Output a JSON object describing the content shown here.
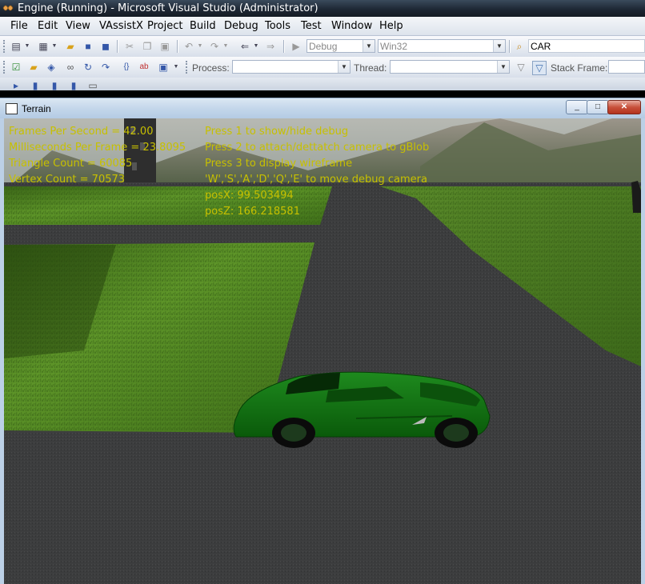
{
  "app": {
    "title": "Engine (Running) - Microsoft Visual Studio (Administrator)"
  },
  "menu": [
    "File",
    "Edit",
    "View",
    "VAssistX",
    "Project",
    "Build",
    "Debug",
    "Tools",
    "Test",
    "Window",
    "Help"
  ],
  "toolbar": {
    "config_value": "Debug",
    "platform_value": "Win32",
    "find_value": "CAR",
    "process_label": "Process:",
    "thread_label": "Thread:",
    "stack_frame_label": "Stack Frame:"
  },
  "terrain_window": {
    "title": "Terrain",
    "minimize": "_",
    "maximize": "□",
    "close": "✕"
  },
  "hud": {
    "fps": "Frames Per Second = 42.00",
    "mspf": "Milliseconds Per Frame = 23.8095",
    "triangles": "Triangle Count = 60085",
    "vertices": "Vertex Count = 70573",
    "help1": "Press 1 to show/hide debug",
    "help2": "Press 2 to attach/dettatch camera to gBlob",
    "help3": "Press 3 to display wireframe",
    "help4": "'W','S','A','D','Q','E' to move debug camera",
    "posx": "posX: 99.503494",
    "posz": "posZ: 166.218581"
  },
  "colors": {
    "hud_text": "#c7c000",
    "grass": "#4a7e1c",
    "road": "#3c3d3e",
    "car": "#0f6e0f"
  }
}
